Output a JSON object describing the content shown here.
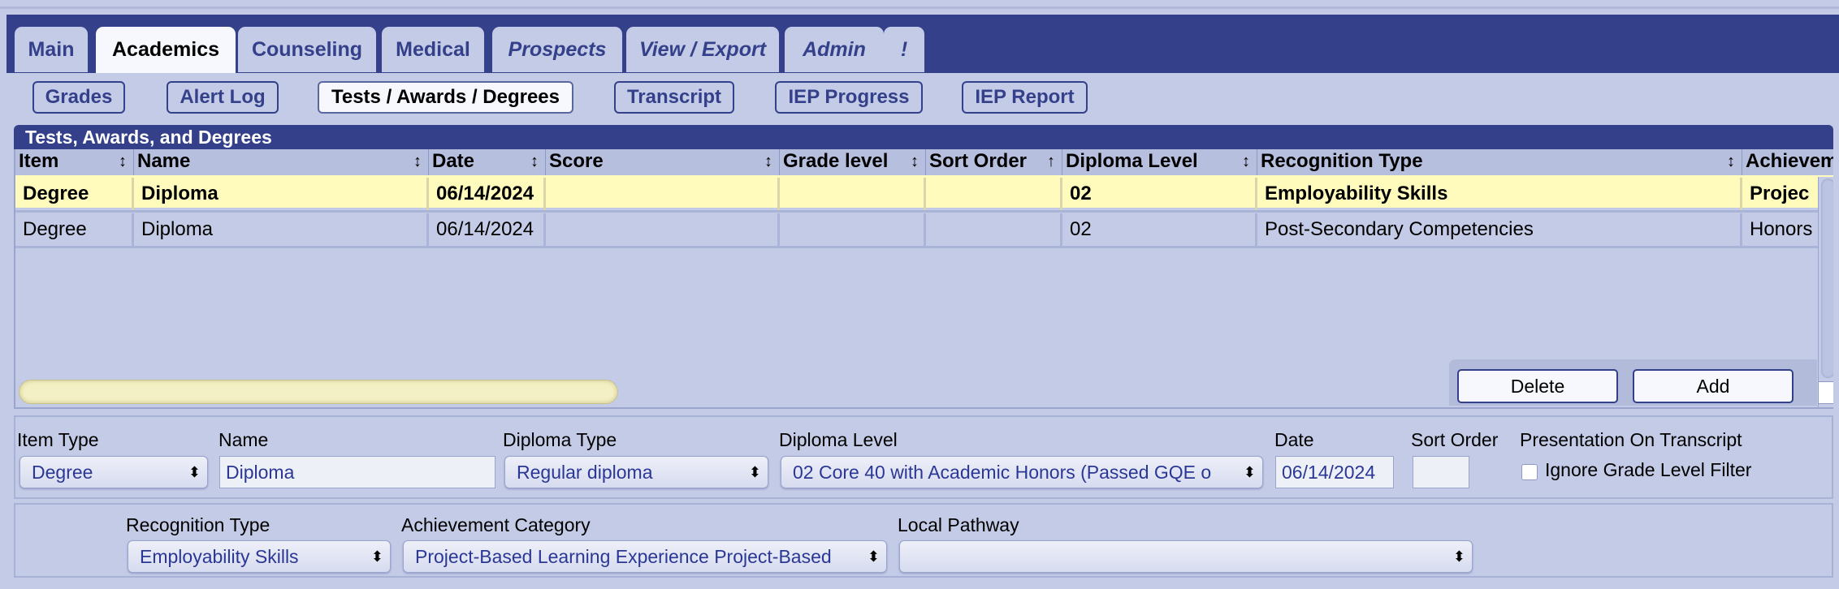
{
  "tabs": [
    {
      "label": "Main"
    },
    {
      "label": "Academics"
    },
    {
      "label": "Counseling"
    },
    {
      "label": "Medical"
    },
    {
      "label": "Prospects"
    },
    {
      "label": "View / Export"
    },
    {
      "label": "Admin"
    },
    {
      "label": "!"
    }
  ],
  "active_tab": "Academics",
  "subnav": [
    {
      "label": "Grades"
    },
    {
      "label": "Alert Log"
    },
    {
      "label": "Tests / Awards / Degrees"
    },
    {
      "label": "Transcript"
    },
    {
      "label": "IEP Progress"
    },
    {
      "label": "IEP Report"
    }
  ],
  "active_subnav": "Tests / Awards / Degrees",
  "panel_title": "Tests, Awards, and Degrees",
  "grid": {
    "columns": [
      {
        "label": "Item",
        "sort": "↕"
      },
      {
        "label": "Name",
        "sort": "↕"
      },
      {
        "label": "Date",
        "sort": "↕"
      },
      {
        "label": "Score",
        "sort": "↕"
      },
      {
        "label": "Grade level",
        "sort": "↕"
      },
      {
        "label": "Sort Order",
        "sort": "↑"
      },
      {
        "label": "Diploma Level",
        "sort": "↕"
      },
      {
        "label": "Recognition Type",
        "sort": "↕"
      },
      {
        "label": "Achievem",
        "sort": ""
      }
    ],
    "rows": [
      {
        "item": "Degree",
        "name": "Diploma",
        "date": "06/14/2024",
        "score": "",
        "grade_level": "",
        "sort_order": "",
        "diploma_level": "02",
        "recognition_type": "Employability Skills",
        "achievement": "Projec",
        "selected": true
      },
      {
        "item": "Degree",
        "name": "Diploma",
        "date": "06/14/2024",
        "score": "",
        "grade_level": "",
        "sort_order": "",
        "diploma_level": "02",
        "recognition_type": "Post-Secondary Competencies",
        "achievement": "Honors",
        "selected": false
      }
    ]
  },
  "actions": {
    "delete_label": "Delete",
    "add_label": "Add"
  },
  "form": {
    "item_type": {
      "label": "Item Type",
      "value": "Degree"
    },
    "name": {
      "label": "Name",
      "value": "Diploma"
    },
    "diploma_type": {
      "label": "Diploma Type",
      "value": "Regular diploma"
    },
    "diploma_level": {
      "label": "Diploma Level",
      "value": "02 Core 40 with Academic Honors (Passed GQE o"
    },
    "date": {
      "label": "Date",
      "value": "06/14/2024"
    },
    "sort_order": {
      "label": "Sort Order",
      "value": ""
    },
    "presentation": {
      "label": "Presentation On Transcript",
      "checkbox_label": "Ignore Grade Level Filter",
      "checked": false
    },
    "recognition_type": {
      "label": "Recognition Type",
      "value": "Employability Skills"
    },
    "achievement_category": {
      "label": "Achievement Category",
      "value": "Project-Based Learning Experience Project-Based"
    },
    "local_pathway": {
      "label": "Local Pathway",
      "value": ""
    }
  },
  "icons": {
    "select_arrow": "up-down-chevron-icon",
    "sort_both": "sort-both-icon",
    "sort_up": "sort-up-icon"
  },
  "colors": {
    "tabbar": "#34408a",
    "background": "#c3cbe6",
    "selected_row": "#fffbbd",
    "link_text": "#2b3795"
  }
}
